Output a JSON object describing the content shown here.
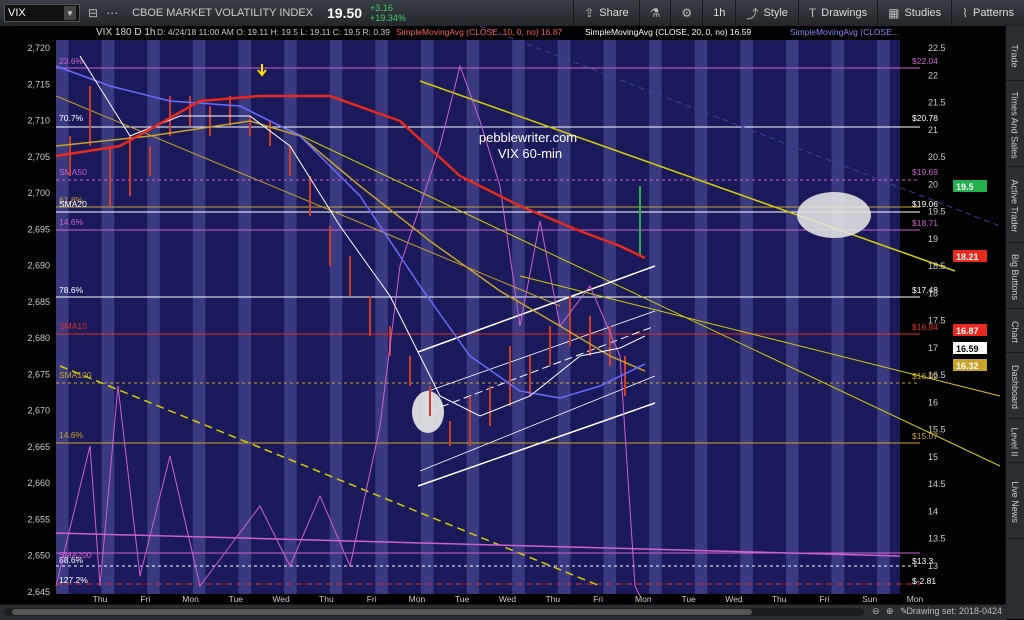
{
  "toolbar": {
    "symbol": "VIX",
    "symbol_name": "CBOE MARKET VOLATILITY INDEX",
    "last": "19.50",
    "change": "+3.16",
    "change_pct": "+19.34%",
    "share_label": "Share",
    "timeframe_label": "1h",
    "style_label": "Style",
    "drawings_label": "Drawings",
    "studies_label": "Studies",
    "patterns_label": "Patterns"
  },
  "chart": {
    "info_line": "VIX 180 D 1h",
    "bar_info": "D: 4/24/18 11:00 AM   O: 19.11   H: 19.5   L: 19.11   C: 19.5   R: 0.39",
    "study_labels": [
      {
        "text": "SimpleMovingAvg (CLOSE, 10, 0, no) 16.87",
        "color": "#ff5a5a"
      },
      {
        "text": "SimpleMovingAvg (CLOSE, 20, 0, no) 16.59",
        "color": "#ffffff"
      },
      {
        "text": "SimpleMovingAvg (CLOSE...",
        "color": "#8888ff"
      }
    ],
    "watermark_1": "pebblewriter.com",
    "watermark_2": "VIX 60-min",
    "left_axis": [
      "2,720",
      "2,715",
      "2,710",
      "2,705",
      "2,700",
      "2,695",
      "2,690",
      "2,685",
      "2,680",
      "2,675",
      "2,670",
      "2,665",
      "2,660",
      "2,655",
      "2,650",
      "2,645"
    ],
    "right_axis": [
      "22.5",
      "22",
      "21.5",
      "21",
      "20.5",
      "20",
      "19.5",
      "19",
      "18.5",
      "18",
      "17.5",
      "17",
      "16.5",
      "16",
      "15.5",
      "15",
      "14.5",
      "14",
      "13.5",
      "13"
    ],
    "x_labels": [
      "Thu",
      "Fri",
      "Mon",
      "Tue",
      "Wed",
      "Thu",
      "Fri",
      "Mon",
      "Tue",
      "Wed",
      "Thu",
      "Fri",
      "Mon",
      "Tue",
      "Wed",
      "Thu",
      "Fri",
      "Sun",
      "Mon"
    ],
    "fib_labels_left": [
      "23.6%",
      "70.7%",
      "SMA50",
      "61.8%",
      "SMA20",
      "14.6%",
      "78.6%",
      "SMA10",
      "SMA100",
      "14.6%",
      "SMA200",
      "88.6%",
      "127.2%"
    ],
    "level_labels_right": [
      "$22.04",
      "$20.78",
      "$19.69",
      "$19.06",
      "$18.71",
      "$17.48",
      "$16.84",
      "$16.02",
      "$15.07",
      "$13.3",
      "$-2.81"
    ],
    "price_tags": [
      {
        "text": "19.5",
        "color": "#22b24c"
      },
      {
        "text": "18.21",
        "color": "#e8291c"
      },
      {
        "text": "16.87",
        "color": "#e8291c"
      },
      {
        "text": "16.59",
        "color": "#ffffff"
      },
      {
        "text": "16.32",
        "color": "#c9a227"
      }
    ]
  },
  "rail": [
    "Trade",
    "Times And Sales",
    "Active Trader",
    "Big Buttons",
    "Chart",
    "Dashboard",
    "Level II",
    "Live News"
  ],
  "footer": {
    "drawing_set": "Drawing set: 2018-0424"
  },
  "colors": {
    "band_dark": "#1a1a5a",
    "band_light": "#3a3a80",
    "sma200": "#e8291c",
    "sma50": "#6b6bff",
    "sma100": "#c9a227",
    "vix": "#d060d0"
  }
}
